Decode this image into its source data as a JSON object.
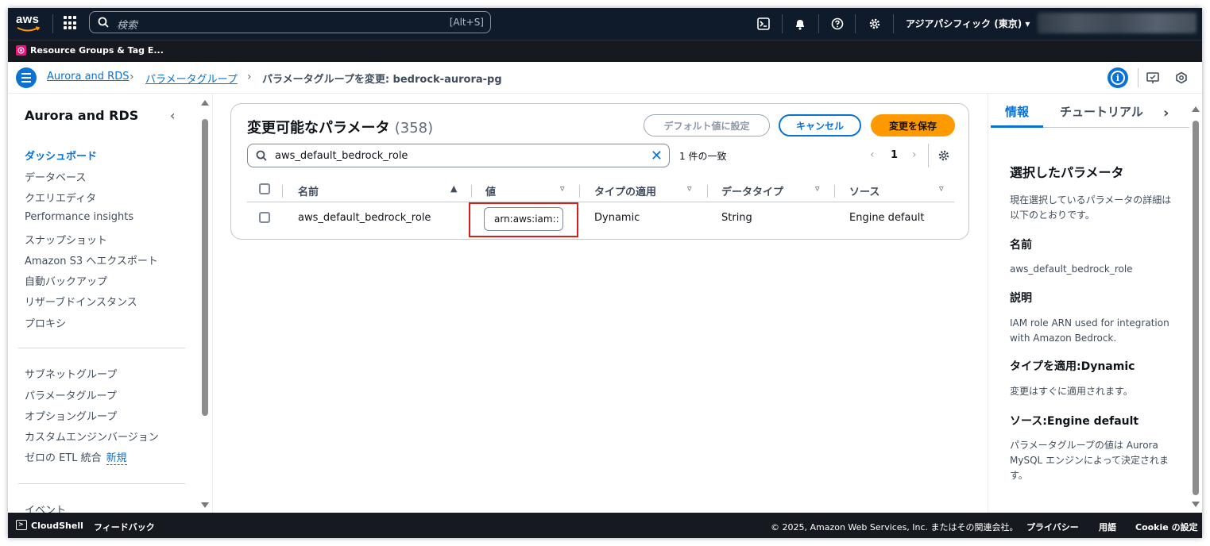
{
  "topnav": {
    "logo": "aws",
    "search_placeholder": "検索",
    "search_shortcut": "[Alt+S]",
    "region": "アジアパシフィック (東京) ▾",
    "icons": [
      "grid-icon",
      "search-icon",
      "cloudshell-icon",
      "bell-icon",
      "help-icon",
      "gear-icon"
    ]
  },
  "favorites": {
    "items": [
      {
        "label": "Resource Groups & Tag E..."
      }
    ]
  },
  "breadcrumb": {
    "items": [
      "Aurora and RDS",
      "パラメータグループ",
      "パラメータグループを変更: bedrock-aurora-pg"
    ]
  },
  "sidebar": {
    "title": "Aurora and RDS",
    "group1": [
      "ダッシュボード",
      "データベース",
      "クエリエディタ",
      "Performance insights",
      "スナップショット",
      "Amazon S3 へエクスポート",
      "自動バックアップ",
      "リザーブドインスタンス",
      "プロキシ"
    ],
    "group2": [
      "サブネットグループ",
      "パラメータグループ",
      "オプショングループ",
      "カスタムエンジンバージョン",
      "ゼロの ETL 統合"
    ],
    "new_badge": "新規",
    "group3": [
      "イベント"
    ]
  },
  "main": {
    "title": "変更可能なパラメータ",
    "count": "(358)",
    "buttons": {
      "default": "デフォルト値に設定",
      "cancel": "キャンセル",
      "save": "変更を保存"
    },
    "filter_value": "aws_default_bedrock_role",
    "match_text": "1 件の一致",
    "page": "1",
    "columns": [
      "名前",
      "値",
      "タイプの適用",
      "データタイプ",
      "ソース"
    ],
    "row": {
      "name": "aws_default_bedrock_role",
      "value": "arn:aws:iam::",
      "apply_type": "Dynamic",
      "data_type": "String",
      "source": "Engine default"
    }
  },
  "help": {
    "tabs": [
      "情報",
      "チュートリアル"
    ],
    "heading": "選択したパラメータ",
    "intro": "現在選択しているパラメータの詳細は以下のとおりです。",
    "name_label": "名前",
    "name_value": "aws_default_bedrock_role",
    "desc_label": "説明",
    "desc_value": "IAM role ARN used for integration with Amazon Bedrock.",
    "apply_label": "タイプを適用:Dynamic",
    "apply_value": "変更はすぐに適用されます。",
    "source_label": "ソース:Engine default",
    "source_value": "パラメータグループの値は Aurora MySQL エンジンによって決定されます。"
  },
  "bottombar": {
    "cloudshell": "CloudShell",
    "feedback": "フィードバック",
    "copyright": "© 2025, Amazon Web Services, Inc. またはその関連会社。",
    "privacy": "プライバシー",
    "terms": "用語",
    "cookie": "Cookie の設定"
  },
  "colors": {
    "primary": "#0972d3",
    "save_button": "#ff9900",
    "nav_background": "#0f1b2a",
    "highlight": "#d91c1c"
  }
}
